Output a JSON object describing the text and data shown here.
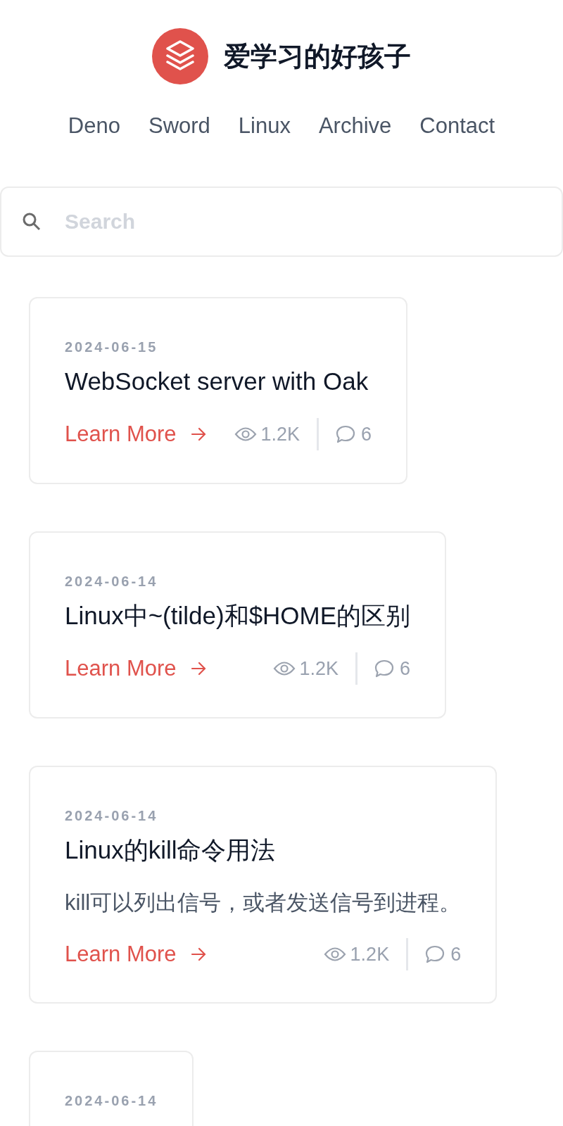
{
  "site": {
    "title": "爱学习的好孩子"
  },
  "nav": [
    {
      "label": "Deno"
    },
    {
      "label": "Sword"
    },
    {
      "label": "Linux"
    },
    {
      "label": "Archive"
    },
    {
      "label": "Contact"
    }
  ],
  "search": {
    "placeholder": "Search"
  },
  "posts": [
    {
      "date": "2024-06-15",
      "title": "WebSocket server with Oak",
      "link": "Learn More",
      "views": "1.2K",
      "comments": "6"
    },
    {
      "date": "2024-06-14",
      "title": "Linux中~(tilde)和$HOME的区别",
      "link": "Learn More",
      "views": "1.2K",
      "comments": "6"
    },
    {
      "date": "2024-06-14",
      "title": "Linux的kill命令用法",
      "excerpt": "kill可以列出信号，或者发送信号到进程。",
      "link": "Learn More",
      "views": "1.2K",
      "comments": "6"
    },
    {
      "date": "2024-06-14"
    }
  ]
}
